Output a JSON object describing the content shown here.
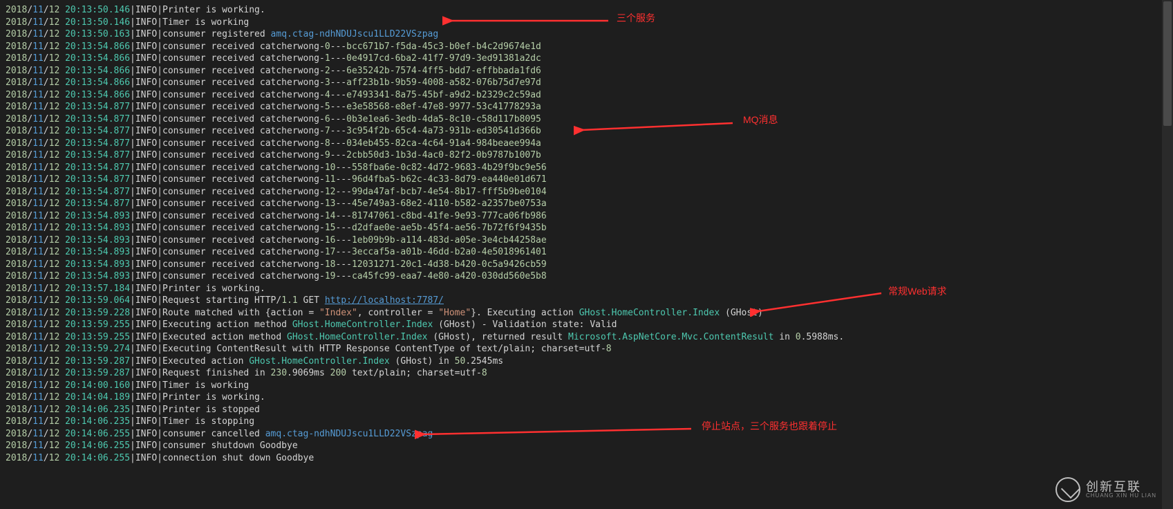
{
  "annotations": {
    "a1": "三个服务",
    "a2": "MQ消息",
    "a3": "常规Web请求",
    "a4": "停止站点，三个服务也跟着停止"
  },
  "watermark": {
    "big": "创新互联",
    "small": "CHUANG XIN HU LIAN"
  },
  "lines": [
    {
      "y": "2018",
      "mo": "11",
      "d": "12",
      "t": "20:13:50.146",
      "lv": "INFO",
      "segs": [
        {
          "c": "msg",
          "v": "Printer is working."
        }
      ]
    },
    {
      "y": "2018",
      "mo": "11",
      "d": "12",
      "t": "20:13:50.146",
      "lv": "INFO",
      "segs": [
        {
          "c": "msg",
          "v": "Timer is working"
        }
      ]
    },
    {
      "y": "2018",
      "mo": "11",
      "d": "12",
      "t": "20:13:50.163",
      "lv": "INFO",
      "segs": [
        {
          "c": "msg",
          "v": "consumer registered "
        },
        {
          "c": "tag",
          "v": "amq.ctag-ndhNDUJscu1LLD22VSzpag"
        }
      ]
    },
    {
      "y": "2018",
      "mo": "11",
      "d": "12",
      "t": "20:13:54.866",
      "lv": "INFO",
      "segs": [
        {
          "c": "msg",
          "v": "consumer received catcherwong-"
        },
        {
          "c": "idx",
          "v": "0"
        },
        {
          "c": "msg",
          "v": "---"
        },
        {
          "c": "guid",
          "v": "bcc671b7-f5da-45c3-b0ef-b4c2d9674e1d"
        }
      ]
    },
    {
      "y": "2018",
      "mo": "11",
      "d": "12",
      "t": "20:13:54.866",
      "lv": "INFO",
      "segs": [
        {
          "c": "msg",
          "v": "consumer received catcherwong-"
        },
        {
          "c": "idx",
          "v": "1"
        },
        {
          "c": "msg",
          "v": "---"
        },
        {
          "c": "guid",
          "v": "0e4917cd-6ba2-41f7-97d9-3ed91381a2dc"
        }
      ]
    },
    {
      "y": "2018",
      "mo": "11",
      "d": "12",
      "t": "20:13:54.866",
      "lv": "INFO",
      "segs": [
        {
          "c": "msg",
          "v": "consumer received catcherwong-"
        },
        {
          "c": "idx",
          "v": "2"
        },
        {
          "c": "msg",
          "v": "---"
        },
        {
          "c": "guid",
          "v": "6e35242b-7574-4ff5-bdd7-effbbada1fd6"
        }
      ]
    },
    {
      "y": "2018",
      "mo": "11",
      "d": "12",
      "t": "20:13:54.866",
      "lv": "INFO",
      "segs": [
        {
          "c": "msg",
          "v": "consumer received catcherwong-"
        },
        {
          "c": "idx",
          "v": "3"
        },
        {
          "c": "msg",
          "v": "---"
        },
        {
          "c": "guid",
          "v": "aff23b1b-9b59-4008-a582-076b75d7e97d"
        }
      ]
    },
    {
      "y": "2018",
      "mo": "11",
      "d": "12",
      "t": "20:13:54.866",
      "lv": "INFO",
      "segs": [
        {
          "c": "msg",
          "v": "consumer received catcherwong-"
        },
        {
          "c": "idx",
          "v": "4"
        },
        {
          "c": "msg",
          "v": "---"
        },
        {
          "c": "guid",
          "v": "e7493341-8a75-45bf-a9d2-b2329c2c59ad"
        }
      ]
    },
    {
      "y": "2018",
      "mo": "11",
      "d": "12",
      "t": "20:13:54.877",
      "lv": "INFO",
      "segs": [
        {
          "c": "msg",
          "v": "consumer received catcherwong-"
        },
        {
          "c": "idx",
          "v": "5"
        },
        {
          "c": "msg",
          "v": "---"
        },
        {
          "c": "guid",
          "v": "e3e58568-e8ef-47e8-9977-53c41778293a"
        }
      ]
    },
    {
      "y": "2018",
      "mo": "11",
      "d": "12",
      "t": "20:13:54.877",
      "lv": "INFO",
      "segs": [
        {
          "c": "msg",
          "v": "consumer received catcherwong-"
        },
        {
          "c": "idx",
          "v": "6"
        },
        {
          "c": "msg",
          "v": "---"
        },
        {
          "c": "guid",
          "v": "0b3e1ea6-3edb-4da5-8c10-c58d117b8095"
        }
      ]
    },
    {
      "y": "2018",
      "mo": "11",
      "d": "12",
      "t": "20:13:54.877",
      "lv": "INFO",
      "segs": [
        {
          "c": "msg",
          "v": "consumer received catcherwong-"
        },
        {
          "c": "idx",
          "v": "7"
        },
        {
          "c": "msg",
          "v": "---"
        },
        {
          "c": "guid",
          "v": "3c954f2b-65c4-4a73-931b-ed30541d366b"
        }
      ]
    },
    {
      "y": "2018",
      "mo": "11",
      "d": "12",
      "t": "20:13:54.877",
      "lv": "INFO",
      "segs": [
        {
          "c": "msg",
          "v": "consumer received catcherwong-"
        },
        {
          "c": "idx",
          "v": "8"
        },
        {
          "c": "msg",
          "v": "---"
        },
        {
          "c": "guid",
          "v": "034eb455-82ca-4c64-91a4-984beaee994a"
        }
      ]
    },
    {
      "y": "2018",
      "mo": "11",
      "d": "12",
      "t": "20:13:54.877",
      "lv": "INFO",
      "segs": [
        {
          "c": "msg",
          "v": "consumer received catcherwong-"
        },
        {
          "c": "idx",
          "v": "9"
        },
        {
          "c": "msg",
          "v": "---"
        },
        {
          "c": "guid",
          "v": "2cbb50d3-1b3d-4ac0-82f2-0b9787b1007b"
        }
      ]
    },
    {
      "y": "2018",
      "mo": "11",
      "d": "12",
      "t": "20:13:54.877",
      "lv": "INFO",
      "segs": [
        {
          "c": "msg",
          "v": "consumer received catcherwong-"
        },
        {
          "c": "idx",
          "v": "10"
        },
        {
          "c": "msg",
          "v": "---"
        },
        {
          "c": "guid",
          "v": "558fba6e-0c82-4d72-9683-4b29f9bc9e56"
        }
      ]
    },
    {
      "y": "2018",
      "mo": "11",
      "d": "12",
      "t": "20:13:54.877",
      "lv": "INFO",
      "segs": [
        {
          "c": "msg",
          "v": "consumer received catcherwong-"
        },
        {
          "c": "idx",
          "v": "11"
        },
        {
          "c": "msg",
          "v": "---"
        },
        {
          "c": "guid",
          "v": "96d4fba5-b62c-4c33-8d79-ea440e01d671"
        }
      ]
    },
    {
      "y": "2018",
      "mo": "11",
      "d": "12",
      "t": "20:13:54.877",
      "lv": "INFO",
      "segs": [
        {
          "c": "msg",
          "v": "consumer received catcherwong-"
        },
        {
          "c": "idx",
          "v": "12"
        },
        {
          "c": "msg",
          "v": "---"
        },
        {
          "c": "guid",
          "v": "99da47af-bcb7-4e54-8b17-fff5b9be0104"
        }
      ]
    },
    {
      "y": "2018",
      "mo": "11",
      "d": "12",
      "t": "20:13:54.877",
      "lv": "INFO",
      "segs": [
        {
          "c": "msg",
          "v": "consumer received catcherwong-"
        },
        {
          "c": "idx",
          "v": "13"
        },
        {
          "c": "msg",
          "v": "---"
        },
        {
          "c": "guid",
          "v": "45e749a3-68e2-4110-b582-a2357be0753a"
        }
      ]
    },
    {
      "y": "2018",
      "mo": "11",
      "d": "12",
      "t": "20:13:54.893",
      "lv": "INFO",
      "segs": [
        {
          "c": "msg",
          "v": "consumer received catcherwong-"
        },
        {
          "c": "idx",
          "v": "14"
        },
        {
          "c": "msg",
          "v": "---"
        },
        {
          "c": "guid",
          "v": "81747061-c8bd-41fe-9e93-777ca06fb986"
        }
      ]
    },
    {
      "y": "2018",
      "mo": "11",
      "d": "12",
      "t": "20:13:54.893",
      "lv": "INFO",
      "segs": [
        {
          "c": "msg",
          "v": "consumer received catcherwong-"
        },
        {
          "c": "idx",
          "v": "15"
        },
        {
          "c": "msg",
          "v": "---"
        },
        {
          "c": "guid",
          "v": "d2dfae0e-ae5b-45f4-ae56-7b72f6f9435b"
        }
      ]
    },
    {
      "y": "2018",
      "mo": "11",
      "d": "12",
      "t": "20:13:54.893",
      "lv": "INFO",
      "segs": [
        {
          "c": "msg",
          "v": "consumer received catcherwong-"
        },
        {
          "c": "idx",
          "v": "16"
        },
        {
          "c": "msg",
          "v": "---"
        },
        {
          "c": "guid",
          "v": "1eb09b9b-a114-483d-a05e-3e4cb44258ae"
        }
      ]
    },
    {
      "y": "2018",
      "mo": "11",
      "d": "12",
      "t": "20:13:54.893",
      "lv": "INFO",
      "segs": [
        {
          "c": "msg",
          "v": "consumer received catcherwong-"
        },
        {
          "c": "idx",
          "v": "17"
        },
        {
          "c": "msg",
          "v": "---"
        },
        {
          "c": "guid",
          "v": "3eccaf5a-a01b-46dd-b2a0-4e5018961401"
        }
      ]
    },
    {
      "y": "2018",
      "mo": "11",
      "d": "12",
      "t": "20:13:54.893",
      "lv": "INFO",
      "segs": [
        {
          "c": "msg",
          "v": "consumer received catcherwong-"
        },
        {
          "c": "idx",
          "v": "18"
        },
        {
          "c": "msg",
          "v": "---"
        },
        {
          "c": "guid",
          "v": "12031271-20c1-4d38-b420-0c5a9426cb59"
        }
      ]
    },
    {
      "y": "2018",
      "mo": "11",
      "d": "12",
      "t": "20:13:54.893",
      "lv": "INFO",
      "segs": [
        {
          "c": "msg",
          "v": "consumer received catcherwong-"
        },
        {
          "c": "idx",
          "v": "19"
        },
        {
          "c": "msg",
          "v": "---"
        },
        {
          "c": "guid",
          "v": "ca45fc99-eaa7-4e80-a420-030dd560e5b8"
        }
      ]
    },
    {
      "y": "2018",
      "mo": "11",
      "d": "12",
      "t": "20:13:57.184",
      "lv": "INFO",
      "segs": [
        {
          "c": "msg",
          "v": "Printer is working."
        }
      ]
    },
    {
      "y": "2018",
      "mo": "11",
      "d": "12",
      "t": "20:13:59.064",
      "lv": "INFO",
      "segs": [
        {
          "c": "msg",
          "v": "Request starting HTTP/"
        },
        {
          "c": "num",
          "v": "1.1"
        },
        {
          "c": "msg",
          "v": " GET "
        },
        {
          "c": "url",
          "v": "http://localhost:7787/"
        }
      ]
    },
    {
      "y": "2018",
      "mo": "11",
      "d": "12",
      "t": "20:13:59.228",
      "lv": "INFO",
      "segs": [
        {
          "c": "msg",
          "v": "Route matched with {action = "
        },
        {
          "c": "str",
          "v": "\"Index\""
        },
        {
          "c": "msg",
          "v": ", controller = "
        },
        {
          "c": "str",
          "v": "\"Home\""
        },
        {
          "c": "msg",
          "v": "}. Executing action "
        },
        {
          "c": "cls",
          "v": "GHost.HomeController.Index"
        },
        {
          "c": "msg",
          "v": " (GHost)"
        }
      ]
    },
    {
      "y": "2018",
      "mo": "11",
      "d": "12",
      "t": "20:13:59.255",
      "lv": "INFO",
      "segs": [
        {
          "c": "msg",
          "v": "Executing action method "
        },
        {
          "c": "cls",
          "v": "GHost.HomeController.Index"
        },
        {
          "c": "msg",
          "v": " (GHost) - Validation state: Valid"
        }
      ]
    },
    {
      "y": "2018",
      "mo": "11",
      "d": "12",
      "t": "20:13:59.255",
      "lv": "INFO",
      "segs": [
        {
          "c": "msg",
          "v": "Executed action method "
        },
        {
          "c": "cls",
          "v": "GHost.HomeController.Index"
        },
        {
          "c": "msg",
          "v": " (GHost), returned result "
        },
        {
          "c": "cls",
          "v": "Microsoft.AspNetCore.Mvc.ContentResult"
        },
        {
          "c": "msg",
          "v": " in "
        },
        {
          "c": "num",
          "v": "0"
        },
        {
          "c": "msg",
          "v": ".5988ms."
        }
      ]
    },
    {
      "y": "2018",
      "mo": "11",
      "d": "12",
      "t": "20:13:59.274",
      "lv": "INFO",
      "segs": [
        {
          "c": "msg",
          "v": "Executing ContentResult with HTTP Response ContentType of text/plain; charset=utf-"
        },
        {
          "c": "num",
          "v": "8"
        }
      ]
    },
    {
      "y": "2018",
      "mo": "11",
      "d": "12",
      "t": "20:13:59.287",
      "lv": "INFO",
      "segs": [
        {
          "c": "msg",
          "v": "Executed action "
        },
        {
          "c": "cls",
          "v": "GHost.HomeController.Index"
        },
        {
          "c": "msg",
          "v": " (GHost) in "
        },
        {
          "c": "num",
          "v": "50"
        },
        {
          "c": "msg",
          "v": ".2545ms"
        }
      ]
    },
    {
      "y": "2018",
      "mo": "11",
      "d": "12",
      "t": "20:13:59.287",
      "lv": "INFO",
      "segs": [
        {
          "c": "msg",
          "v": "Request finished in "
        },
        {
          "c": "num",
          "v": "230"
        },
        {
          "c": "msg",
          "v": ".9069ms "
        },
        {
          "c": "num",
          "v": "200"
        },
        {
          "c": "msg",
          "v": " text/plain; charset=utf-"
        },
        {
          "c": "num",
          "v": "8"
        }
      ]
    },
    {
      "y": "2018",
      "mo": "11",
      "d": "12",
      "t": "20:14:00.160",
      "lv": "INFO",
      "segs": [
        {
          "c": "msg",
          "v": "Timer is working"
        }
      ]
    },
    {
      "y": "2018",
      "mo": "11",
      "d": "12",
      "t": "20:14:04.189",
      "lv": "INFO",
      "segs": [
        {
          "c": "msg",
          "v": "Printer is working."
        }
      ]
    },
    {
      "y": "2018",
      "mo": "11",
      "d": "12",
      "t": "20:14:06.235",
      "lv": "INFO",
      "segs": [
        {
          "c": "msg",
          "v": "Printer is stopped"
        }
      ]
    },
    {
      "y": "2018",
      "mo": "11",
      "d": "12",
      "t": "20:14:06.235",
      "lv": "INFO",
      "segs": [
        {
          "c": "msg",
          "v": "Timer is stopping"
        }
      ]
    },
    {
      "y": "2018",
      "mo": "11",
      "d": "12",
      "t": "20:14:06.255",
      "lv": "INFO",
      "segs": [
        {
          "c": "msg",
          "v": "consumer cancelled "
        },
        {
          "c": "tag",
          "v": "amq.ctag-ndhNDUJscu1LLD22VSzpag"
        }
      ]
    },
    {
      "y": "2018",
      "mo": "11",
      "d": "12",
      "t": "20:14:06.255",
      "lv": "INFO",
      "segs": [
        {
          "c": "msg",
          "v": "consumer shutdown Goodbye"
        }
      ]
    },
    {
      "y": "2018",
      "mo": "11",
      "d": "12",
      "t": "20:14:06.255",
      "lv": "INFO",
      "segs": [
        {
          "c": "msg",
          "v": "connection shut down Goodbye"
        }
      ]
    }
  ]
}
